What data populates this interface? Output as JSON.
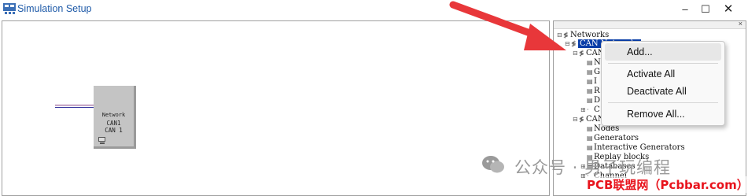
{
  "window": {
    "title": "Simulation Setup",
    "minimize": "–",
    "maximize": "☐",
    "close": "✕"
  },
  "canvas": {
    "network_block": {
      "line1": "Network",
      "line2": "CAN1",
      "line3": "CAN 1",
      "icon": "pc-icon"
    }
  },
  "panel": {
    "close": "×",
    "tree": [
      {
        "label": "Networks",
        "icon": "network-icon"
      },
      {
        "label": "CAN Networks",
        "icon": "network-icon"
      },
      {
        "label": "CAN",
        "icon": "network-icon"
      },
      {
        "label": "N",
        "icon": "node-icon"
      },
      {
        "label": "G",
        "icon": "node-icon"
      },
      {
        "label": "I",
        "icon": "node-icon"
      },
      {
        "label": "R",
        "icon": "node-icon"
      },
      {
        "label": "D",
        "icon": "node-icon"
      },
      {
        "label": "C",
        "icon": "node-icon"
      },
      {
        "label": "CAN",
        "icon": "network-icon"
      },
      {
        "label": "Nodes",
        "icon": "node-icon"
      },
      {
        "label": "Generators",
        "icon": "node-icon"
      },
      {
        "label": "Interactive Generators",
        "icon": "node-icon"
      },
      {
        "label": "Replay blocks",
        "icon": "node-icon"
      },
      {
        "label": "Databases",
        "icon": "node-icon"
      },
      {
        "label": "Channel",
        "icon": "node-icon"
      }
    ]
  },
  "context_menu": {
    "items": [
      "Add...",
      "Activate All",
      "Deactivate All",
      "Remove All..."
    ]
  },
  "watermark": {
    "wechat": "公众号 · 男子玩编程",
    "site": "PCB联盟网（Pcbbar.com）"
  },
  "colors": {
    "selection": "#0a3ea8",
    "title_text": "#1e5aa8",
    "arrow": "#e8373a",
    "watermark_red": "#e8141d"
  }
}
